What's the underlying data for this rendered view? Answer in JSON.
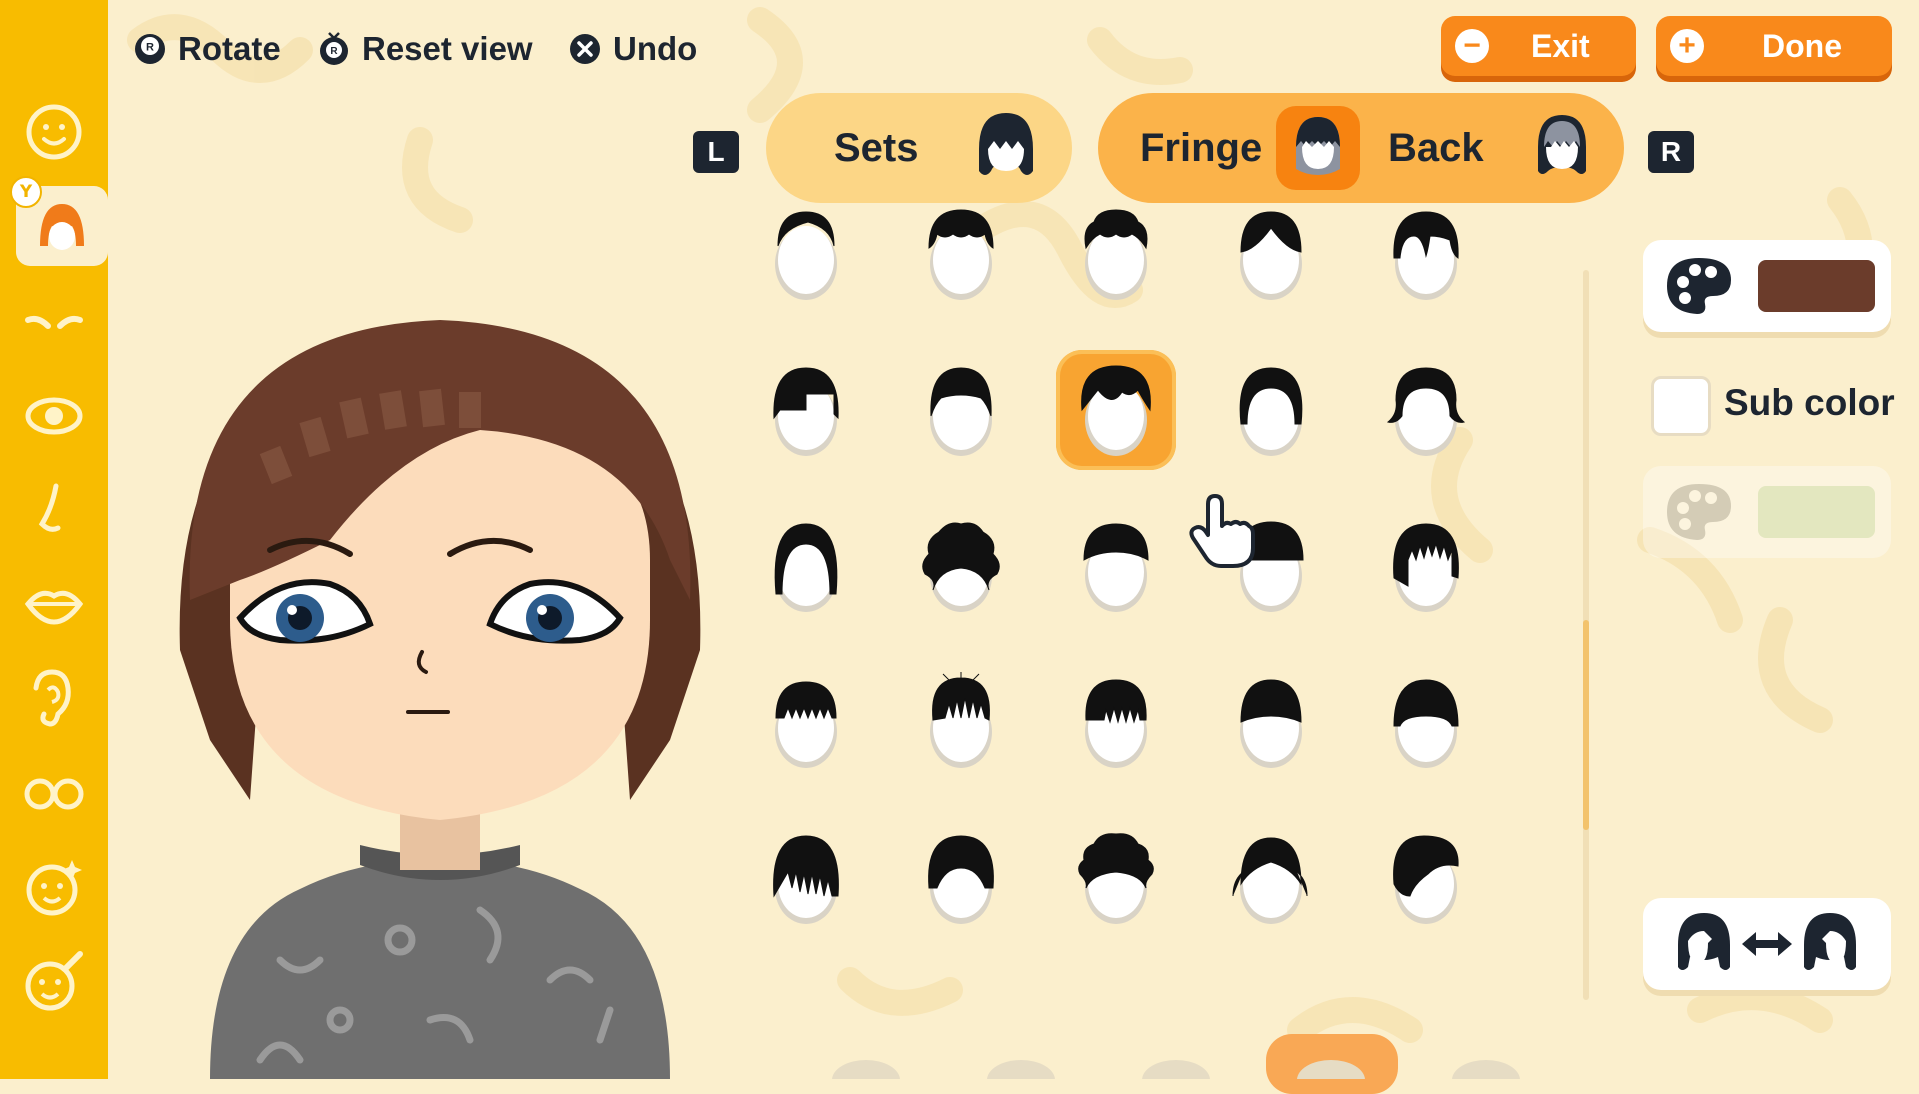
{
  "controls": {
    "rotate_label": "Rotate",
    "reset_label": "Reset view",
    "undo_label": "Undo"
  },
  "buttons": {
    "exit_label": "Exit",
    "done_label": "Done"
  },
  "tabs": {
    "l_key": "L",
    "r_key": "R",
    "items": [
      {
        "label": "Sets",
        "selected": false
      },
      {
        "label": "Fringe",
        "selected": true
      },
      {
        "label": "Back",
        "selected": false
      }
    ]
  },
  "sidebar": {
    "y_badge": "Y",
    "items": [
      "face-shape-icon",
      "hair-icon",
      "eyebrows-icon",
      "eyes-icon",
      "nose-icon",
      "mouth-icon",
      "ears-icon",
      "glasses-icon",
      "makeup-icon",
      "facial-features-icon"
    ],
    "active_index": 1
  },
  "hair_grid": {
    "rows": 5,
    "columns": 5,
    "selected_row": 1,
    "selected_col": 2
  },
  "color": {
    "main": "#6b3c2b",
    "sub_label": "Sub color",
    "sub_enabled": false,
    "sub_color": "#b9d9a6"
  },
  "colors": {
    "sidebar": "#f8bc00",
    "accent_orange": "#f9891b",
    "background": "#fbefcd"
  }
}
